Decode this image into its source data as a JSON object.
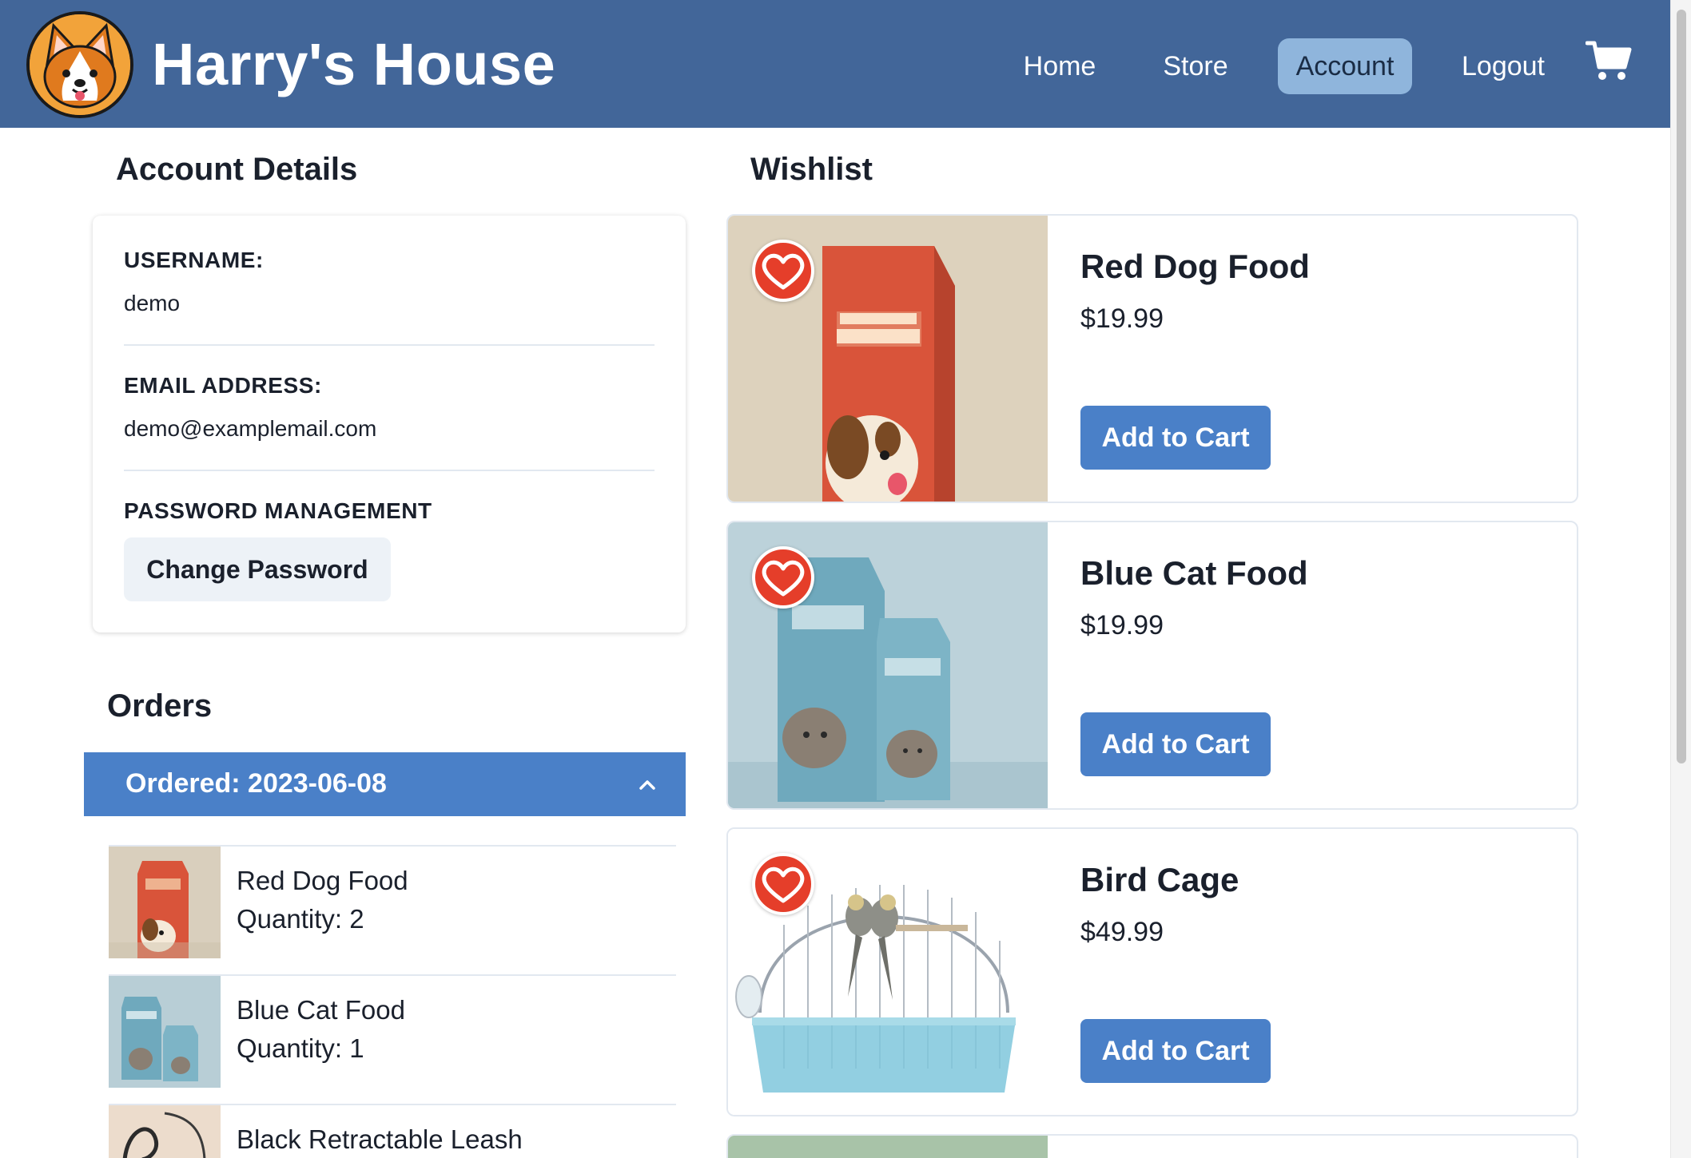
{
  "header": {
    "brand": "Harry's House",
    "nav": {
      "home": "Home",
      "store": "Store",
      "account": "Account",
      "logout": "Logout"
    },
    "active_nav": "Account",
    "logo_icon": "corgi-logo",
    "cart_icon": "cart-icon",
    "color": "#426699"
  },
  "account": {
    "title": "Account Details",
    "username_label": "USERNAME:",
    "username": "demo",
    "email_label": "EMAIL ADDRESS:",
    "email": "demo@examplemail.com",
    "password_label": "PASSWORD MANAGEMENT",
    "change_password": "Change Password"
  },
  "orders": {
    "title": "Orders",
    "groups": [
      {
        "label": "Ordered: 2023-06-08",
        "expanded": true,
        "items": [
          {
            "name": "Red Dog Food",
            "quantity": "Quantity: 2"
          },
          {
            "name": "Blue Cat Food",
            "quantity": "Quantity: 1"
          },
          {
            "name": "Black Retractable Leash",
            "quantity": ""
          }
        ]
      }
    ]
  },
  "wishlist": {
    "title": "Wishlist",
    "items": [
      {
        "name": "Red Dog Food",
        "price": "$19.99",
        "button": "Add to Cart",
        "favorited": true
      },
      {
        "name": "Blue Cat Food",
        "price": "$19.99",
        "button": "Add to Cart",
        "favorited": true
      },
      {
        "name": "Bird Cage",
        "price": "$49.99",
        "button": "Add to Cart",
        "favorited": true
      }
    ]
  },
  "colors": {
    "accent": "#4a80c8",
    "heart": "#e53e2a",
    "active_nav_bg": "#8fb5dc"
  }
}
